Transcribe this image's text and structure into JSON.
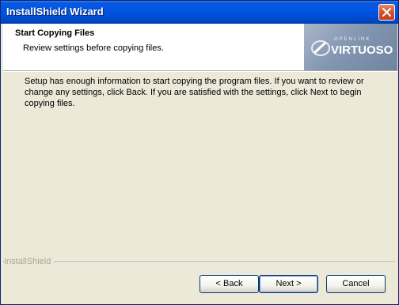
{
  "window": {
    "title": "InstallShield Wizard",
    "close_icon": "close-icon"
  },
  "header": {
    "title": "Start Copying Files",
    "subtitle": "Review settings before copying files.",
    "logo": {
      "small_text": "OPENLINK",
      "big_text": "VIRTUOSO"
    }
  },
  "body": {
    "text": "Setup has enough information to start copying the program files.  If you want to review or change any settings, click Back.  If you are satisfied with the settings, click Next to begin copying files."
  },
  "footer": {
    "brand": "InstallShield",
    "buttons": {
      "back": "< Back",
      "next": "Next >",
      "cancel": "Cancel"
    }
  },
  "colors": {
    "titlebar": "#0054e3",
    "dialog_bg": "#ece9d8",
    "logo_bg": "#8497b1"
  }
}
